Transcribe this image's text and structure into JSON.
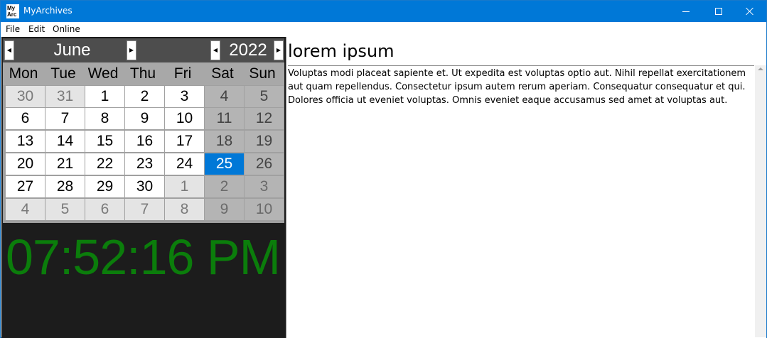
{
  "window": {
    "title": "MyArchives",
    "icon_text": [
      "My",
      "Arc"
    ]
  },
  "menu": [
    "File",
    "Edit",
    "Online"
  ],
  "calendar": {
    "month": "June",
    "year": "2022",
    "day_names": [
      "Mon",
      "Tue",
      "Wed",
      "Thu",
      "Fri",
      "Sat",
      "Sun"
    ],
    "weeks": [
      [
        "30",
        "31",
        "1",
        "2",
        "3",
        "4",
        "5"
      ],
      [
        "6",
        "7",
        "8",
        "9",
        "10",
        "11",
        "12"
      ],
      [
        "13",
        "14",
        "15",
        "16",
        "17",
        "18",
        "19"
      ],
      [
        "20",
        "21",
        "22",
        "23",
        "24",
        "25",
        "26"
      ],
      [
        "27",
        "28",
        "29",
        "30",
        "1",
        "2",
        "3"
      ],
      [
        "4",
        "5",
        "6",
        "7",
        "8",
        "9",
        "10"
      ]
    ],
    "selected": "25",
    "prev_icon": "triangle-left",
    "next_icon": "triangle-right"
  },
  "clock": {
    "time": "07:52:16 PM",
    "color": "#0b7d0b"
  },
  "document": {
    "title": "lorem ipsum",
    "body": "Voluptas modi placeat sapiente et. Ut expedita est voluptas optio aut. Nihil repellat exercitationem aut quam repellendus. Consectetur ipsum autem rerum aperiam. Consequatur consequatur et qui. Dolores officia ut eveniet voluptas. Omnis eveniet eaque accusamus sed amet at voluptas aut."
  },
  "colors": {
    "titlebar": "#0078d7",
    "selected_day": "#0078d7"
  }
}
